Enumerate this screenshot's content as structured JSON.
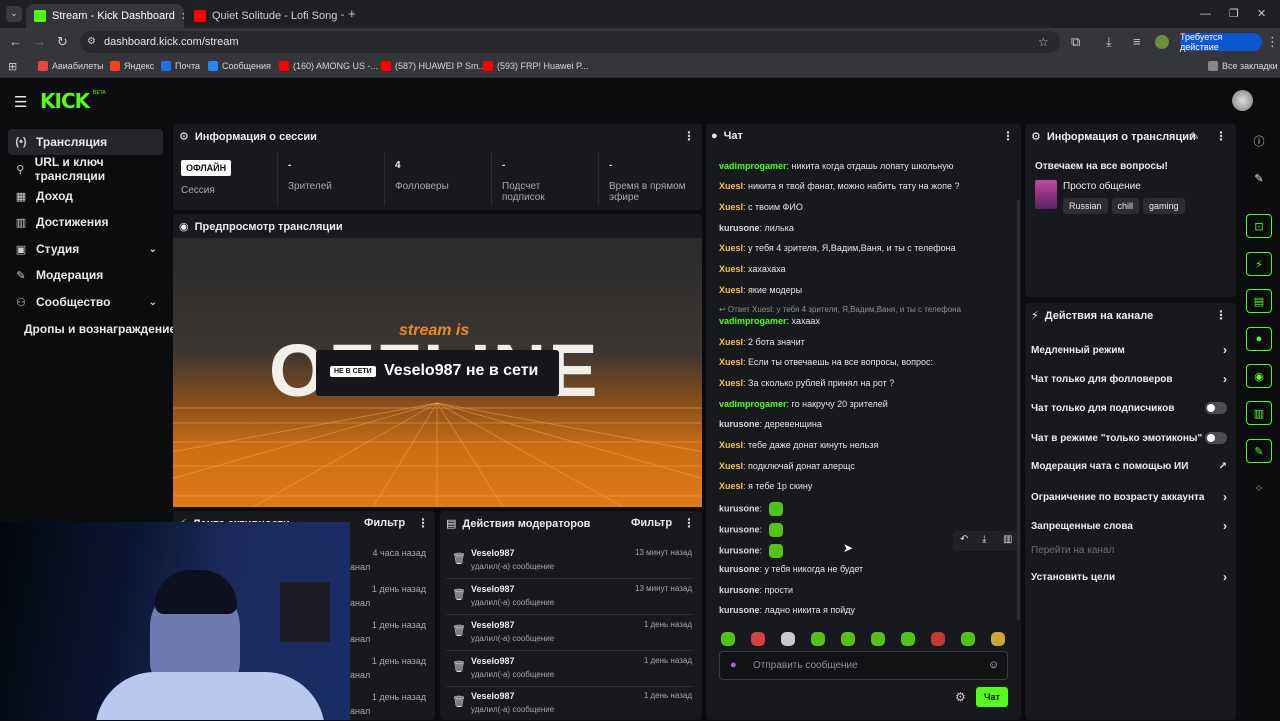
{
  "browser": {
    "tabs": [
      {
        "title": "Stream - Kick Dashboard",
        "color": "#53fc18"
      },
      {
        "title": "Quiet Solitude - Lofi Song ~ Lo",
        "color": "#ff0000"
      }
    ],
    "url": "dashboard.kick.com/stream",
    "action_button": "Требуется действие",
    "bookmarks": [
      {
        "label": "Авиабилеты",
        "color": "#e44"
      },
      {
        "label": "Яндекс",
        "color": "#fc3f1d"
      },
      {
        "label": "Почта",
        "color": "#1a73e8"
      },
      {
        "label": "Сообщения",
        "color": "#2787f5"
      },
      {
        "label": "(160) AMONG US -...",
        "color": "#ff0000"
      },
      {
        "label": "(587) HUAWEI P Sm...",
        "color": "#ff0000"
      },
      {
        "label": "(593) FRP! Huawei P...",
        "color": "#ff0000"
      }
    ],
    "all_bookmarks": "Все закладки"
  },
  "kick": {
    "logo": "KICK",
    "beta": "BETA"
  },
  "sidebar": {
    "items": [
      {
        "label": "Трансляция",
        "icon": "(•)"
      },
      {
        "label": "URL и ключ трансляции",
        "icon": "⚲"
      },
      {
        "label": "Доход",
        "icon": "▦"
      },
      {
        "label": "Достижения",
        "icon": "▥"
      },
      {
        "label": "Студия",
        "icon": "▣"
      },
      {
        "label": "Модерация",
        "icon": "✎"
      },
      {
        "label": "Сообщество",
        "icon": "⚇"
      },
      {
        "label": "Дропы и вознаграждение",
        "icon": ""
      }
    ]
  },
  "session": {
    "title": "Информация о сессии",
    "badge": "ОФЛАЙН",
    "stats": [
      {
        "value": "",
        "label": "Сессия"
      },
      {
        "value": "-",
        "label": "Зрителей"
      },
      {
        "value": "4",
        "label": "Фолловеры"
      },
      {
        "value": "-",
        "label": "Подсчет подписок"
      },
      {
        "value": "-",
        "label": "Время в прямом эфире"
      }
    ]
  },
  "preview": {
    "title": "Предпросмотр трансляции",
    "stream_is": "stream is",
    "big_word": "OFFLINE",
    "badge": "НЕ В СЕТИ",
    "status": "Veselo987 не в сети"
  },
  "activity": {
    "title": "Лента активности",
    "filter": "Фильтр",
    "rows": [
      {
        "time": "4 часа назад",
        "sub": "анал"
      },
      {
        "time": "1 день назад",
        "sub": "анал"
      },
      {
        "time": "1 день назад",
        "sub": "анал"
      },
      {
        "time": "1 день назад",
        "sub": "анал"
      },
      {
        "time": "1 день назад",
        "sub": "анал"
      }
    ]
  },
  "mod_actions": {
    "title": "Действия модераторов",
    "filter": "Фильтр",
    "rows": [
      {
        "user": "Veselo987",
        "action": "удалил(-а) сообщение",
        "time": "13 минут назад"
      },
      {
        "user": "Veselo987",
        "action": "удалил(-а) сообщение",
        "time": "13 минут назад"
      },
      {
        "user": "Veselo987",
        "action": "удалил(-а) сообщение",
        "time": "1 день назад"
      },
      {
        "user": "Veselo987",
        "action": "удалил(-а) сообщение",
        "time": "1 день назад"
      },
      {
        "user": "Veselo987",
        "action": "удалил(-а) сообщение",
        "time": "1 день назад"
      }
    ]
  },
  "chat": {
    "title": "Чат",
    "messages": [
      {
        "user": "vadimprogamer",
        "text": "никита когда отдашь лопату школьную",
        "color": "#53fc18"
      },
      {
        "user": "Xuesl",
        "text": "никита я твой фанат, можно набить тату на жопе ?",
        "color": "#f2c34b"
      },
      {
        "user": "Xuesl",
        "text": "с твоим ФИО",
        "color": "#f2c34b"
      },
      {
        "user": "kurusone",
        "text": "лилька",
        "color": "#d9d9d9"
      },
      {
        "user": "Xuesl",
        "text": "у тебя 4 зрителя, Я,Вадим,Ваня, и ты с телефона",
        "color": "#f2c34b"
      },
      {
        "user": "Xuesl",
        "text": "хахахаха",
        "color": "#f2c34b"
      },
      {
        "user": "Xuesl",
        "text": "якие модеры",
        "color": "#f2c34b"
      },
      {
        "user": "vadimprogamer",
        "text": "хахаах",
        "color": "#53fc18"
      },
      {
        "user": "Xuesl",
        "text": "2 бота значит",
        "color": "#f2c34b"
      },
      {
        "user": "Xuesl",
        "text": "Если ты отвечаешь на все вопросы, вопрос:",
        "color": "#f2c34b"
      },
      {
        "user": "Xuesl",
        "text": "За сколько рублей принял на рот ?",
        "color": "#f2c34b"
      },
      {
        "user": "vadimprogamer",
        "text": "го накручу 20 зрителей",
        "color": "#53fc18"
      },
      {
        "user": "kurusone",
        "text": "деревенщина",
        "color": "#d9d9d9"
      },
      {
        "user": "Xuesl",
        "text": "тебе даже донат кинуть нельзя",
        "color": "#f2c34b"
      },
      {
        "user": "Xuesl",
        "text": "подключай донат алерщс",
        "color": "#f2c34b"
      },
      {
        "user": "Xuesl",
        "text": "я тебе 1р скину",
        "color": "#f2c34b"
      },
      {
        "user": "kurusone",
        "text": "",
        "color": "#d9d9d9"
      },
      {
        "user": "kurusone",
        "text": "",
        "color": "#d9d9d9"
      },
      {
        "user": "kurusone",
        "text": "",
        "color": "#d9d9d9"
      },
      {
        "user": "kurusone",
        "text": "у тебя никогда не будет",
        "color": "#d9d9d9"
      },
      {
        "user": "kurusone",
        "text": "прости",
        "color": "#d9d9d9"
      },
      {
        "user": "kurusone",
        "text": "ладно никита я пойду",
        "color": "#d9d9d9"
      }
    ],
    "reply_note": "↩ Ответ Xuesl: у тебя 4 зрителя, Я,Вадим,Ваня, и ты с телефона",
    "input_placeholder": "Отправить сообщение",
    "send_label": "Чат"
  },
  "stream_info": {
    "title": "Информация о трансляции",
    "stream_title": "Отвечаем на все вопросы!",
    "category": "Просто общение",
    "tags": [
      "Russian",
      "chill",
      "gaming"
    ]
  },
  "channel_actions": {
    "title": "Действия на канале",
    "items": [
      {
        "label": "Медленный режим",
        "kind": "arrow"
      },
      {
        "label": "Чат только для фолловеров",
        "kind": "arrow"
      },
      {
        "label": "Чат только для подписчиков",
        "kind": "toggle"
      },
      {
        "label": "Чат в режиме \"только эмотиконы\"",
        "kind": "toggle"
      },
      {
        "label": "Модерация чата с помощью ИИ",
        "kind": "external"
      },
      {
        "label": "Ограничение по возрасту аккаунта",
        "kind": "arrow"
      },
      {
        "label": "Запрещенные слова",
        "kind": "arrow"
      },
      {
        "label": "Перейти на канал",
        "kind": "muted"
      },
      {
        "label": "Установить цели",
        "kind": "arrow"
      }
    ]
  },
  "colors": {
    "accent": "#53fc18",
    "bg": "#0b0c0e",
    "panel": "#18191c"
  }
}
